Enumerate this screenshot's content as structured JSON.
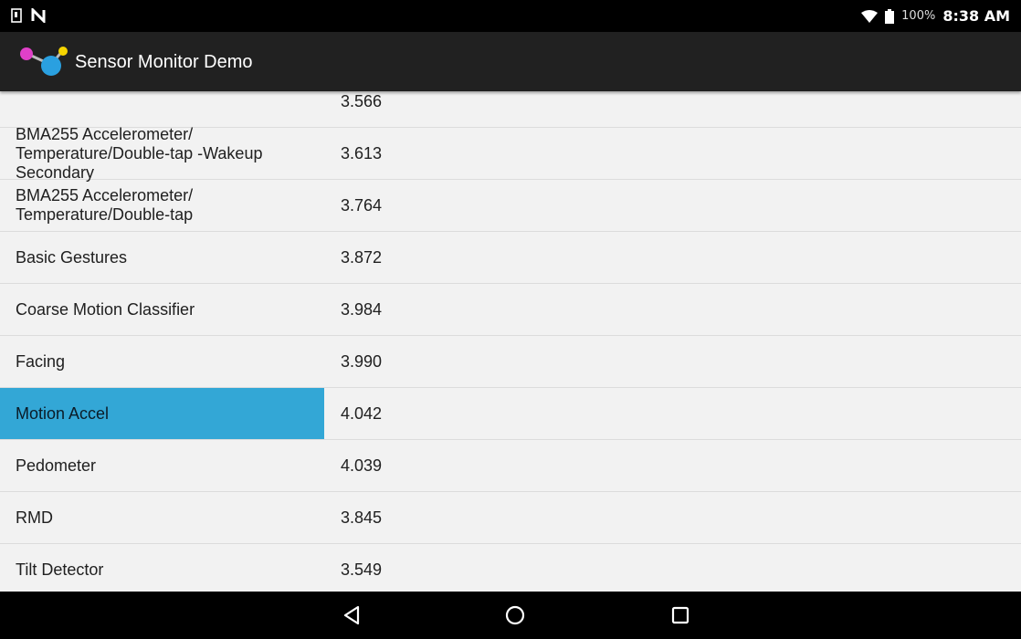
{
  "status_bar": {
    "battery_text": "100%",
    "time": "8:38 AM"
  },
  "app": {
    "title": "Sensor Monitor Demo"
  },
  "list": {
    "rows": [
      {
        "name": "",
        "value": "3.566"
      },
      {
        "name": "BMA255 Accelerometer/\nTemperature/Double-tap -Wakeup Secondary",
        "value": "3.613"
      },
      {
        "name": "BMA255 Accelerometer/\nTemperature/Double-tap",
        "value": "3.764"
      },
      {
        "name": "Basic Gestures",
        "value": "3.872"
      },
      {
        "name": "Coarse Motion Classifier",
        "value": "3.984"
      },
      {
        "name": "Facing",
        "value": "3.990"
      },
      {
        "name": "Motion Accel",
        "value": "4.042",
        "selected": true
      },
      {
        "name": "Pedometer",
        "value": "4.039"
      },
      {
        "name": "RMD",
        "value": "3.845"
      },
      {
        "name": "Tilt Detector",
        "value": "3.549"
      }
    ]
  },
  "colors": {
    "selected_row": "#33a7d6",
    "action_bar": "#212121"
  },
  "icons": {
    "status_left": [
      "sim-card-icon",
      "nfc-n-icon"
    ],
    "status_right": [
      "wifi-icon",
      "battery-icon"
    ],
    "nav": [
      "back-icon",
      "home-icon",
      "recents-icon"
    ]
  }
}
